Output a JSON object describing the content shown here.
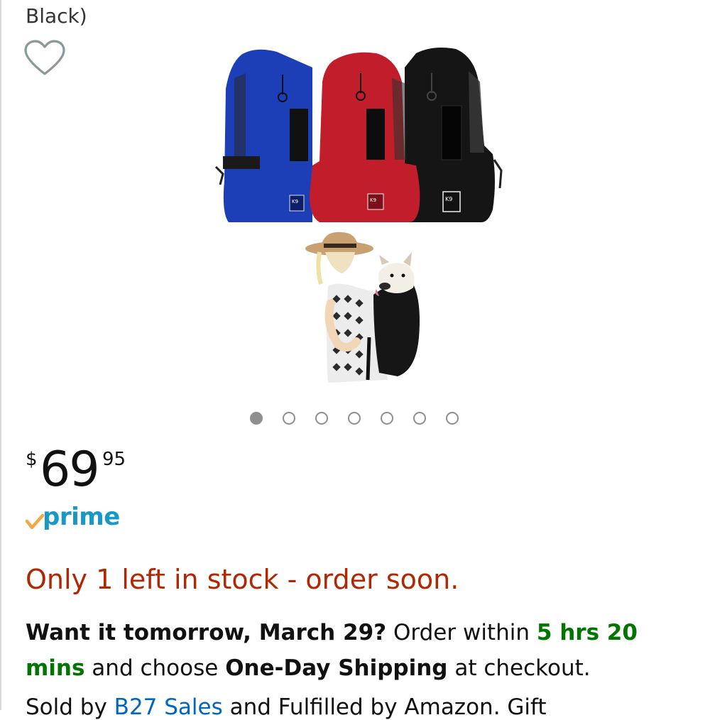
{
  "product": {
    "title_tail": "Black)"
  },
  "gallery": {
    "image_count": 7,
    "active_index": 0,
    "bag_colors": [
      "#1c3fb8",
      "#c11d2a",
      "#151515"
    ],
    "bag_logo": "K9"
  },
  "price": {
    "currency": "$",
    "whole": "69",
    "fraction": "95"
  },
  "prime": {
    "label": "prime",
    "check_color": "#f3a847",
    "word_color": "#1a98c4"
  },
  "stock": {
    "message": "Only 1 left in stock - order soon.",
    "color": "#b12704"
  },
  "delivery": {
    "lead": "Want it tomorrow, March 29?",
    "order_within": " Order within ",
    "countdown": "5 hrs 20 mins",
    "and_choose": " and choose ",
    "shipping": "One-Day Shipping",
    "tail": " at checkout."
  },
  "seller": {
    "prefix": "Sold by ",
    "name": "B27 Sales",
    "suffix": " and Fulfilled by Amazon. Gift"
  },
  "icons": {
    "wishlist": "heart-outline-icon",
    "prime_check": "checkmark-icon"
  }
}
